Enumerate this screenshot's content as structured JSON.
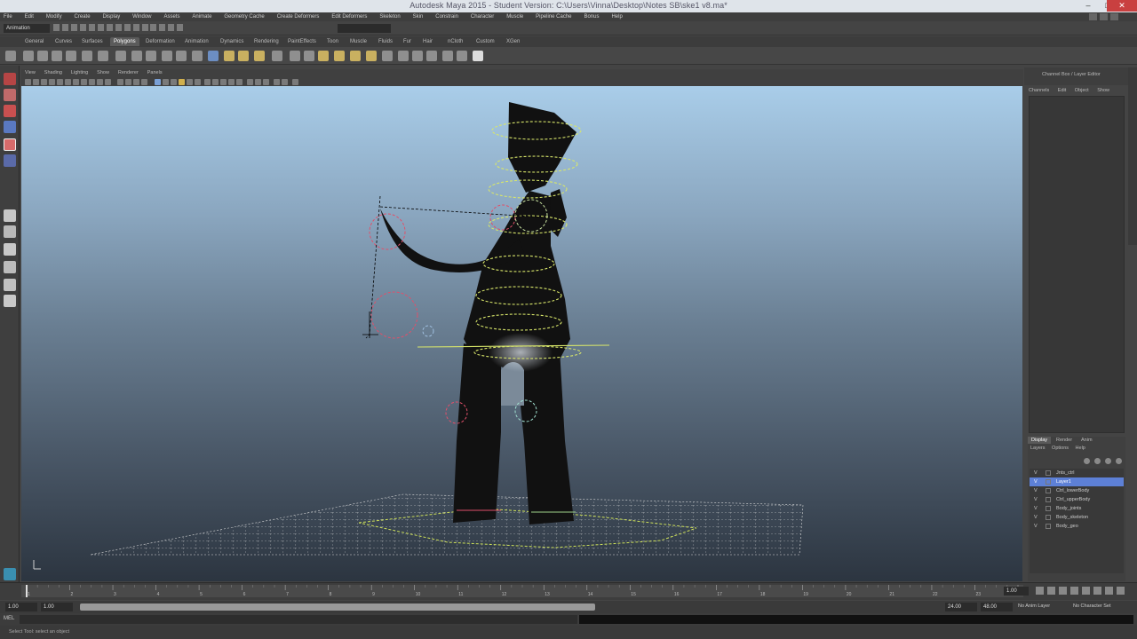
{
  "window": {
    "title": "Autodesk Maya 2015 - Student Version: C:\\Users\\Vinna\\Desktop\\Notes SB\\ske1 v8.ma*",
    "minimize": "–",
    "maximize": "□",
    "close": "✕"
  },
  "menubar": {
    "items": [
      "File",
      "Edit",
      "Modify",
      "Create",
      "Display",
      "Window",
      "Assets",
      "Animate",
      "Geometry Cache",
      "Create Deformers",
      "Edit Deformers",
      "Skeleton",
      "Skin",
      "Constrain",
      "Character",
      "Muscle",
      "Pipeline Cache",
      "Bonus",
      "Help"
    ]
  },
  "statusline": {
    "mode": "Animation"
  },
  "shelf": {
    "tabs": [
      "General",
      "Curves",
      "Surfaces",
      "Polygons",
      "Deformation",
      "Animation",
      "Dynamics",
      "Rendering",
      "PaintEffects",
      "Toon",
      "Muscle",
      "Fluids",
      "Fur",
      "Hair",
      "nCloth",
      "Custom",
      "XGen"
    ],
    "active_tab": 3
  },
  "panel": {
    "menus": [
      "View",
      "Shading",
      "Lighting",
      "Show",
      "Renderer",
      "Panels"
    ]
  },
  "channelbox": {
    "title": "Channel Box / Layer Editor",
    "menus": [
      "Channels",
      "Edit",
      "Object",
      "Show"
    ]
  },
  "layer_editor": {
    "tabs": [
      "Display",
      "Render",
      "Anim"
    ],
    "menus": [
      "Layers",
      "Options",
      "Help"
    ],
    "layers": [
      {
        "visible": "V",
        "playback": "",
        "name": "Jnts_ctrl",
        "selected": false
      },
      {
        "visible": "V",
        "playback": "",
        "name": "Layer1",
        "selected": true
      },
      {
        "visible": "V",
        "playback": "R",
        "name": "Ctrl_lowerBody",
        "selected": false
      },
      {
        "visible": "V",
        "playback": "R",
        "name": "Ctrl_upperBody",
        "selected": false
      },
      {
        "visible": "V",
        "playback": "R",
        "name": "Body_joints",
        "selected": false
      },
      {
        "visible": "V",
        "playback": "R",
        "name": "Body_skeleton",
        "selected": false
      },
      {
        "visible": "V",
        "playback": "R",
        "name": "Body_geo",
        "selected": false
      }
    ]
  },
  "timeline": {
    "current_frame": "1.00",
    "range_start": "1.00",
    "start_frame": "1.00",
    "end_frame": "24.00",
    "range_end": "48.00",
    "anim_layer": "No Anim Layer",
    "character": "No Character Set",
    "tick_labels": [
      "1",
      "2",
      "3",
      "4",
      "5",
      "6",
      "7",
      "8",
      "9",
      "10",
      "11",
      "12",
      "13",
      "14",
      "15",
      "16",
      "17",
      "18",
      "19",
      "20",
      "21",
      "22",
      "23",
      "24"
    ]
  },
  "commandline": {
    "label": "MEL"
  },
  "helpline": {
    "text": "Select Tool: select an object"
  },
  "colors": {
    "accent_selection": "#5d80d6",
    "viewport_top": "#a9cde9",
    "viewport_bottom": "#2c3540",
    "control_yellow": "#d8e66a",
    "control_red": "#e0506a",
    "grid_line": "#e8e8e8"
  }
}
